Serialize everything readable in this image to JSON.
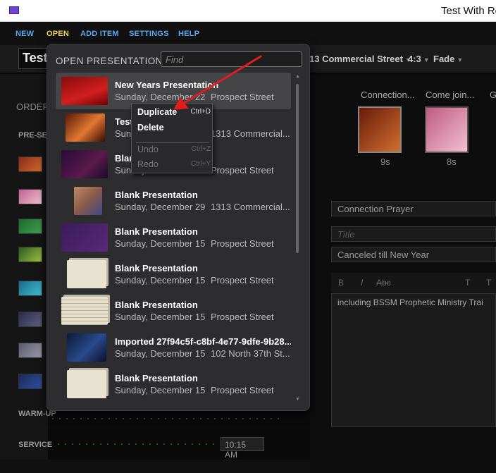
{
  "window": {
    "title": "Test With Re"
  },
  "menu": {
    "items": [
      {
        "label": "NEW",
        "active": false
      },
      {
        "label": "OPEN",
        "active": true
      },
      {
        "label": "ADD ITEM",
        "active": false
      },
      {
        "label": "SETTINGS",
        "active": false
      },
      {
        "label": "HELP",
        "active": false
      }
    ]
  },
  "toolbar": {
    "presentation_title": "Test",
    "location": "13 Commercial Street",
    "aspect": "4:3",
    "transition": "Fade"
  },
  "left_panel": {
    "order_label": "ORDER",
    "pre_service_label": "PRE-SE",
    "warm_up_label": "WARM-UP",
    "service_label": "SERVICE",
    "service_time": "10:15 AM"
  },
  "slides": {
    "items": [
      {
        "label": "Connection...",
        "duration": "9s"
      },
      {
        "label": "Come join...",
        "duration": "8s"
      },
      {
        "label": "G",
        "duration": ""
      }
    ]
  },
  "editor": {
    "item_name": "Connection Prayer",
    "title_placeholder": "Title",
    "subtitle": "Canceled till New Year",
    "format_buttons": [
      "B",
      "I",
      "Abc",
      "T",
      "T"
    ],
    "body": "including BSSM Prophetic Ministry Trai"
  },
  "open_presentation": {
    "title": "OPEN PRESENTATION",
    "find_placeholder": "Find",
    "presentations": [
      {
        "name": "New Years Presentation",
        "date": "Sunday, December 22",
        "location": "Prospect Street",
        "thumb": "red",
        "selected": true
      },
      {
        "name": "Test",
        "date": "Sunday",
        "location": "1313 Commercial...",
        "thumb": "orange",
        "selected": false
      },
      {
        "name": "Blank",
        "date": "Sunday",
        "location": "Prospect Street",
        "thumb": "purple",
        "selected": false
      },
      {
        "name": "Blank Presentation",
        "date": "Sunday, December 29",
        "location": "1313 Commercial...",
        "thumb": "photo",
        "selected": false
      },
      {
        "name": "Blank Presentation",
        "date": "Sunday, December 15",
        "location": "Prospect Street",
        "thumb": "violet",
        "selected": false
      },
      {
        "name": "Blank Presentation",
        "date": "Sunday, December 15",
        "location": "Prospect Street",
        "thumb": "beige",
        "selected": false
      },
      {
        "name": "Blank Presentation",
        "date": "Sunday, December 15",
        "location": "Prospect Street",
        "thumb": "text",
        "selected": false
      },
      {
        "name": "Imported 27f94c5f-c8bf-4e77-9dfe-9b28...",
        "date": "Sunday, December 15",
        "location": "102 North 37th St...",
        "thumb": "navy",
        "selected": false
      },
      {
        "name": "Blank Presentation",
        "date": "Sunday, December 15",
        "location": "Prospect Street",
        "thumb": "beige",
        "selected": false
      }
    ]
  },
  "context_menu": {
    "items": [
      {
        "label": "Duplicate",
        "shortcut": "Ctrl+D",
        "enabled": true
      },
      {
        "label": "Delete",
        "shortcut": "",
        "enabled": true
      },
      {
        "label": "Undo",
        "shortcut": "Ctrl+Z",
        "enabled": false
      },
      {
        "label": "Redo",
        "shortcut": "Ctrl+Y",
        "enabled": false
      }
    ]
  },
  "colors": {
    "menu_link": "#5aa8f0",
    "menu_active": "#f2d34a",
    "annotation_arrow": "#e11d1d"
  }
}
